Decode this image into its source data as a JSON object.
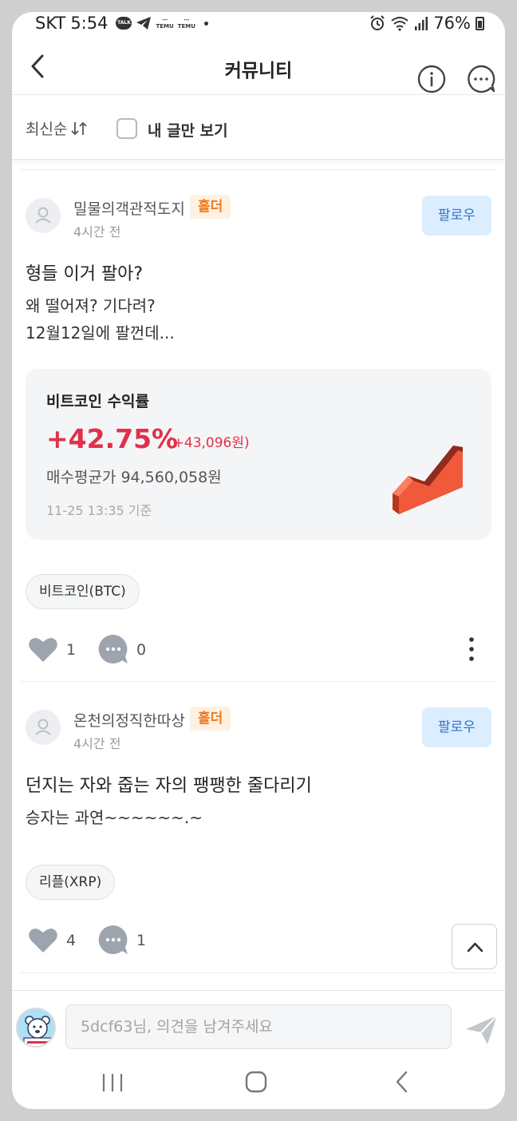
{
  "status_bar": {
    "carrier": "SKT",
    "time": "5:54",
    "battery": "76%",
    "icons": [
      "kakaotalk-icon",
      "telegram-icon",
      "temu-icon",
      "temu-icon",
      "alarm-icon",
      "wifi-icon",
      "signal-icon",
      "battery-icon"
    ],
    "talk_badge": "TALK",
    "temu_label": "TEMU"
  },
  "header": {
    "title": "커뮤니티"
  },
  "filter": {
    "sort_label": "최신순",
    "my_posts_label": "내 글만 보기",
    "my_posts_checked": false
  },
  "posts": [
    {
      "author": "밀물의객관적도지",
      "badge": "홀더",
      "time": "4시간 전",
      "follow_label": "팔로우",
      "title": "형들 이거 팔아?",
      "body_lines": [
        "왜 떨어져? 기다려?",
        "12월12일에 팔껀데..."
      ],
      "profit_card": {
        "title": "비트코인 수익률",
        "percent": "+42.75%",
        "amount": "(+43,096원)",
        "avg_price": "매수평균가 94,560,058원",
        "timestamp": "11-25 13:35 기준",
        "accent_color": "#e0314a"
      },
      "tag": "비트코인(BTC)",
      "likes": "1",
      "comments": "0"
    },
    {
      "author": "온천의정직한따상",
      "badge": "홀더",
      "time": "4시간 전",
      "follow_label": "팔로우",
      "title": "던지는 자와 줍는 자의 팽팽한 줄다리기",
      "body_lines": [
        "승자는 과연~~~~~~.~"
      ],
      "tag": "리플(XRP)",
      "likes": "4",
      "comments": "1"
    }
  ],
  "comment_bar": {
    "placeholder": "5dcf63님, 의견을 남겨주세요"
  },
  "colors": {
    "follow_bg": "#dbeeff",
    "follow_text": "#2d72c6",
    "badge_bg": "#fff1e2",
    "badge_text": "#f07a1d",
    "profit_red": "#e0314a"
  }
}
